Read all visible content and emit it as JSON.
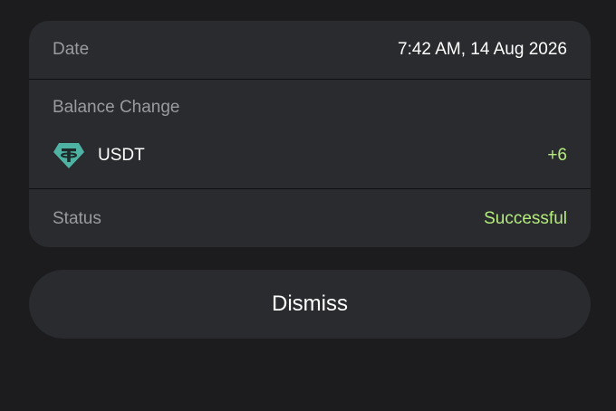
{
  "details": {
    "date_label": "Date",
    "date_value": "7:42 AM, 14 Aug 2026",
    "balance_label": "Balance Change",
    "token": {
      "icon": "tether-icon",
      "name": "USDT",
      "change": "+6"
    },
    "status_label": "Status",
    "status_value": "Successful"
  },
  "actions": {
    "dismiss_label": "Dismiss"
  },
  "colors": {
    "background": "#1c1c1e",
    "card": "#2a2b2e",
    "muted_text": "#9a9b9f",
    "positive": "#b4ec7e",
    "tether": "#4fb3a4"
  }
}
